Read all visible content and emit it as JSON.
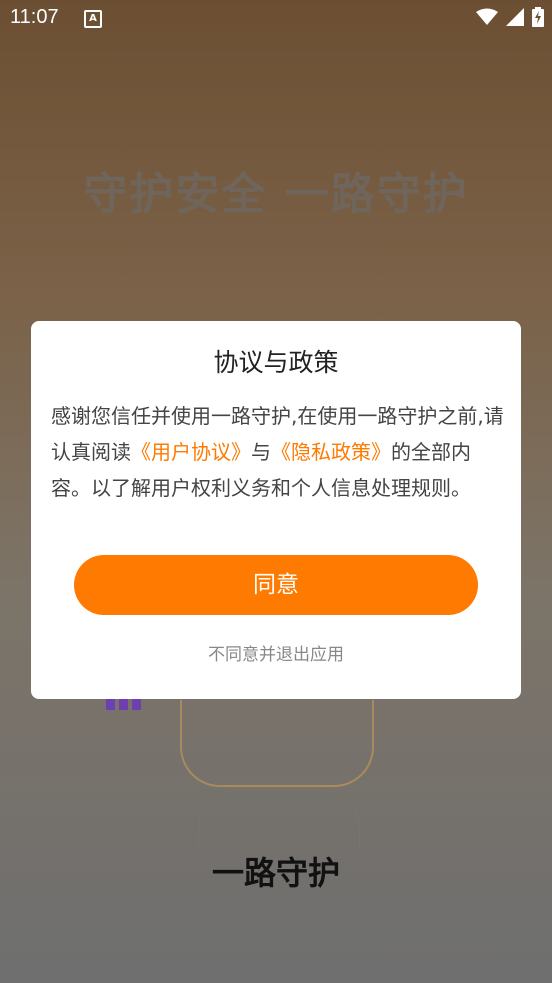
{
  "status_bar": {
    "time": "11:07",
    "icons": [
      "a-notification-icon",
      "wifi-icon",
      "signal-icon",
      "battery-charging-icon"
    ]
  },
  "background": {
    "slogan": "守护安全 一路守护",
    "app_name": "一路守护"
  },
  "dialog": {
    "title": "协议与政策",
    "body_part1": "感谢您信任并使用一路守护,在使用一路守护之前,请认真阅读",
    "link_user_agreement": "《用户协议》",
    "body_and": "与",
    "link_privacy_policy": "《隐私政策》",
    "body_part2": "的全部内容。以了解用户权利义务和个人信息处理规则。",
    "agree_label": "同意",
    "decline_label": "不同意并退出应用"
  },
  "colors": {
    "accent": "#ff7a00",
    "dialog_bg": "#ffffff"
  }
}
